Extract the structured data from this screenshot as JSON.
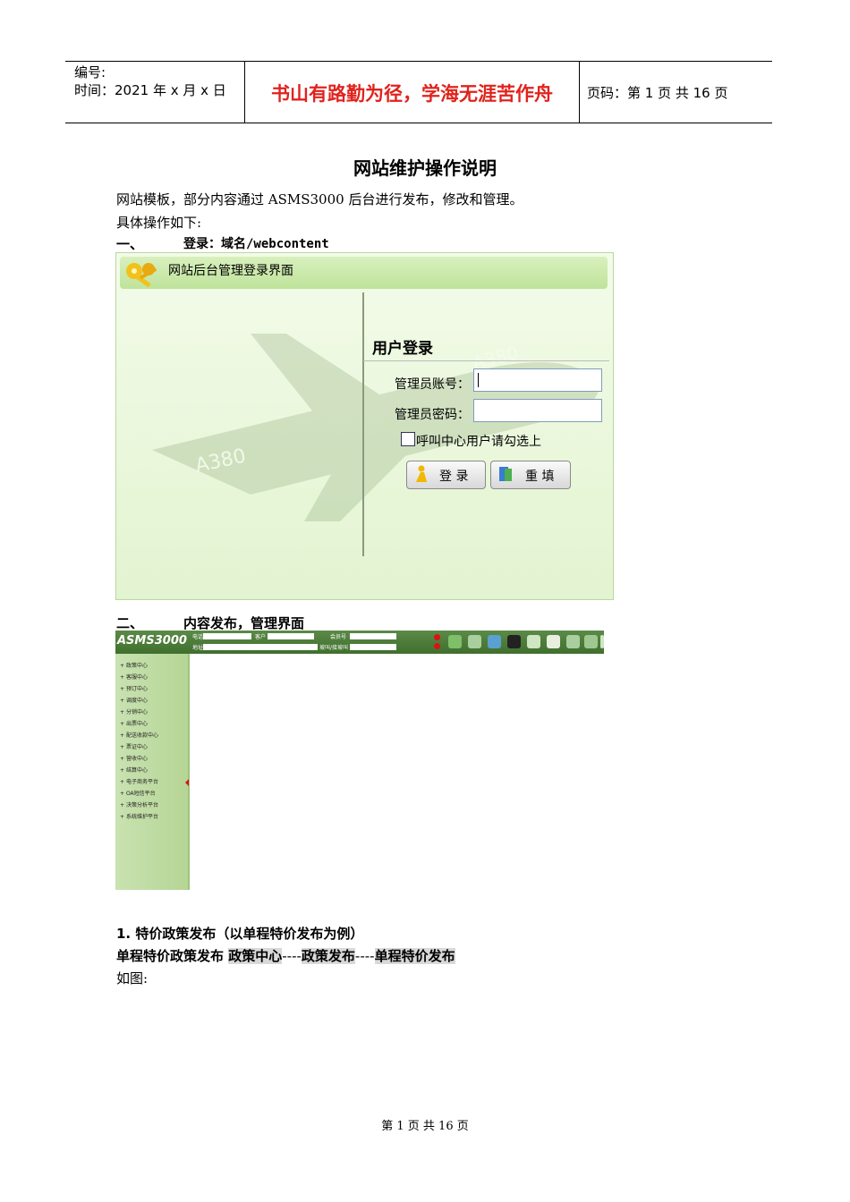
{
  "header": {
    "number_label": "编号:",
    "time_label": "时间：2021 年 x 月 x 日",
    "motto": "书山有路勤为径，学海无涯苦作舟",
    "page_label": "页码：第 1 页  共 16 页"
  },
  "doc": {
    "title": "网站维护操作说明",
    "intro1": "网站模板，部分内容通过 ASMS3000 后台进行发布，修改和管理。",
    "intro2": "具体操作如下:",
    "step1_num": "一、",
    "step1_text": "登录：域名/webcontent",
    "step2_num": "二、",
    "step2_text": "内容发布，管理界面",
    "sub1": "1.    特价政策发布（以单程特价发布为例）",
    "path_lead": "单程特价政策发布 ",
    "path_a": "政策中心",
    "path_sep1": "----",
    "path_b": "政策发布",
    "path_sep2": "----",
    "path_c": "单程特价发布",
    "figure_label": "如图:"
  },
  "login": {
    "bar_title": "网站后台管理登录界面",
    "heading": "用户登录",
    "account_label": "管理员账号：",
    "password_label": "管理员密码：",
    "checkbox_label": "呼叫中心用户请勾选上",
    "login_button": "登 录",
    "reset_button": "重 填",
    "plane_text_1": "A380",
    "plane_text_2": "A380"
  },
  "asms": {
    "logo": "ASMS3000",
    "field_phone": "电话",
    "field_customer": "客户",
    "field_member": "会员号",
    "field_address": "地址",
    "field_pass": "坡叫/接坡叫",
    "menu": [
      "政策中心",
      "客服中心",
      "预订中心",
      "调度中心",
      "分销中心",
      "出票中心",
      "配送收款中心",
      "票证中心",
      "营收中心",
      "结算中心",
      "电子商务平台",
      "OA短信平台",
      "决策分析平台",
      "系统维护平台"
    ]
  },
  "footer": {
    "page_text": "第  1  页  共  16  页"
  }
}
